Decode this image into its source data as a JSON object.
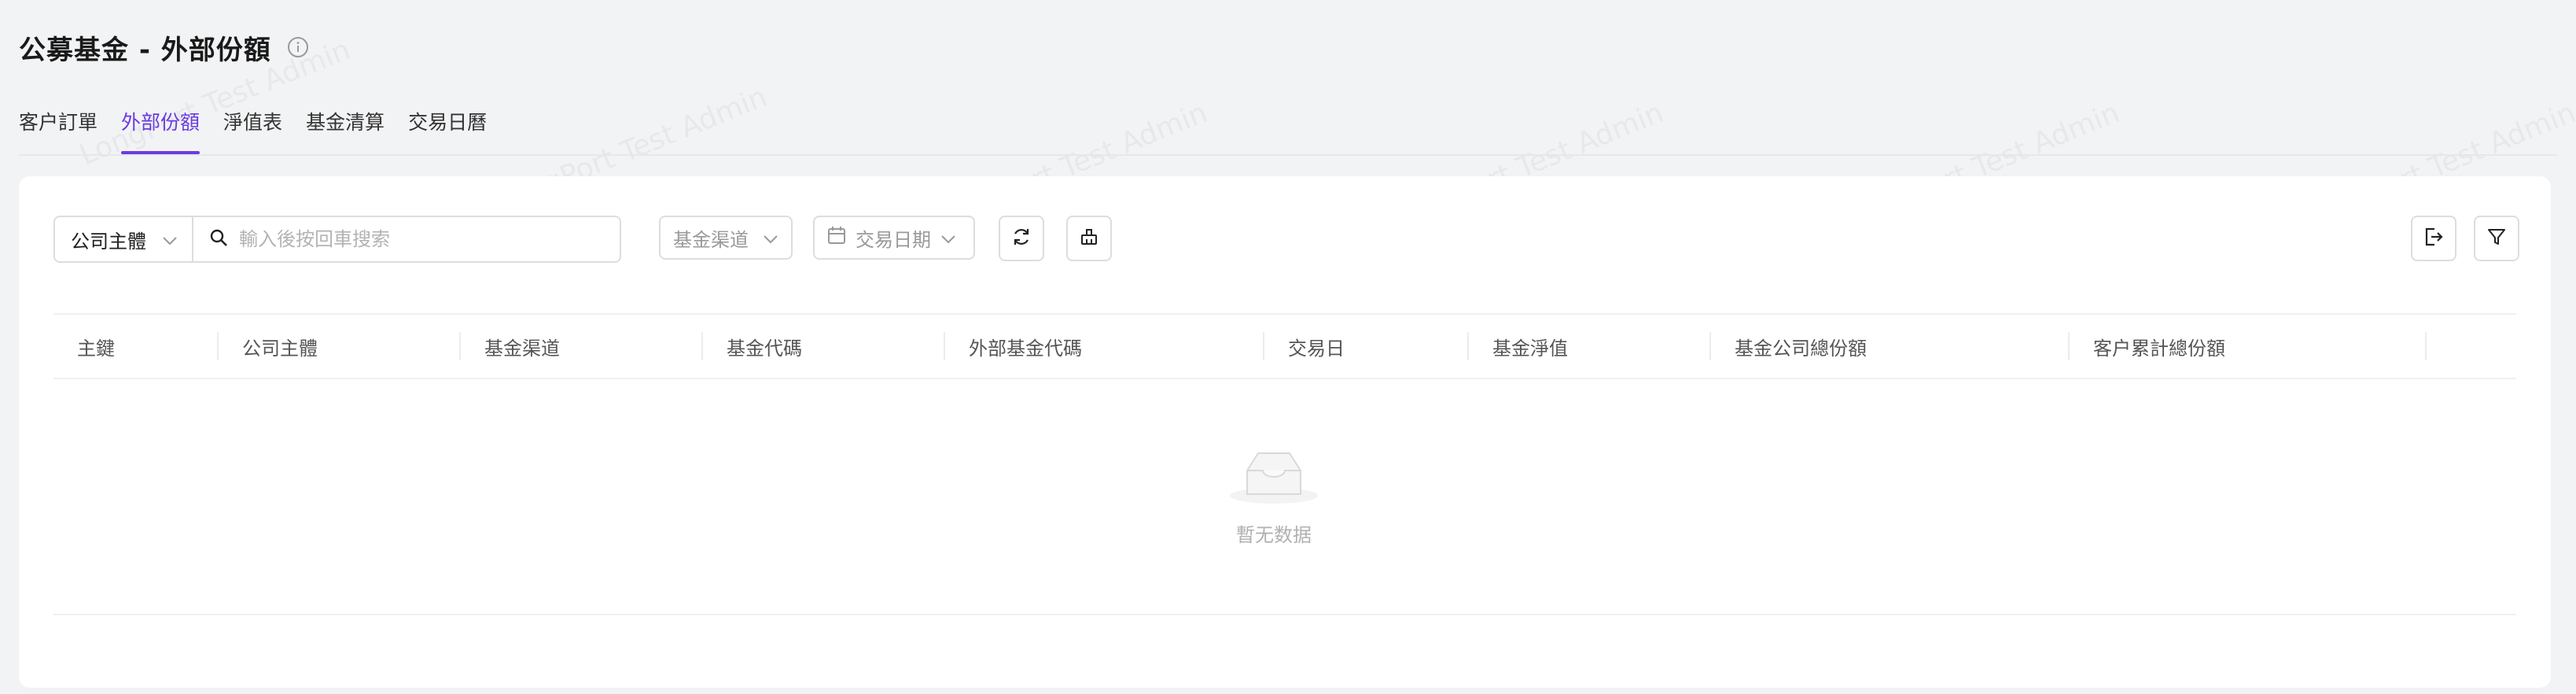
{
  "page": {
    "title": "公募基金 - 外部份額"
  },
  "tabs": [
    {
      "label": "客户訂單",
      "active": false
    },
    {
      "label": "外部份額",
      "active": true
    },
    {
      "label": "淨值表",
      "active": false
    },
    {
      "label": "基金清算",
      "active": false
    },
    {
      "label": "交易日曆",
      "active": false
    }
  ],
  "filters": {
    "entity_select": "公司主體",
    "search_placeholder": "輸入後按回車搜索",
    "channel_placeholder": "基金渠道",
    "date_placeholder": "交易日期"
  },
  "table": {
    "columns": [
      "主鍵",
      "公司主體",
      "基金渠道",
      "基金代碼",
      "外部基金代碼",
      "交易日",
      "基金淨值",
      "基金公司總份額",
      "客户累計總份額"
    ],
    "rows": [],
    "empty_text": "暫无数据"
  },
  "watermark": "LongPort Test Admin",
  "colors": {
    "accent": "#6a3ce0",
    "background": "#f2f3f5",
    "card": "#ffffff"
  },
  "icons": [
    "info-icon",
    "chevron-down-icon",
    "search-icon",
    "calendar-icon",
    "refresh-icon",
    "clear-icon",
    "export-icon",
    "filter-icon",
    "empty-inbox-icon"
  ]
}
